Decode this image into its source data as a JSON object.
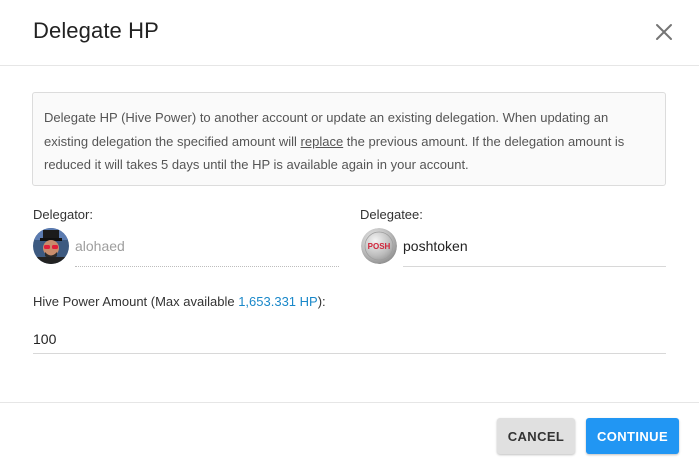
{
  "dialog": {
    "title": "Delegate HP",
    "close_icon": "close-icon"
  },
  "info": {
    "part1": "Delegate HP (Hive Power) to another account or update an existing delegation. When updating an existing delegation the specified amount will ",
    "underlined": "replace",
    "part2": " the previous amount. If the delegation amount is reduced it will takes 5 days until the HP is available again in your account."
  },
  "delegator": {
    "label": "Delegator:",
    "account": "alohaed",
    "avatar_icon": "user-avatar"
  },
  "delegatee": {
    "label": "Delegatee:",
    "account": "poshtoken",
    "avatar_icon": "posh-logo",
    "avatar_text": "POSH"
  },
  "amount": {
    "label_prefix": "Hive Power Amount (Max available ",
    "max_value": "1,653.331 HP",
    "label_suffix": "):",
    "value": "100"
  },
  "buttons": {
    "cancel": "CANCEL",
    "continue": "CONTINUE"
  },
  "colors": {
    "accent": "#2196f3",
    "link": "#1a88c9",
    "cancel_bg": "#e0e0e0"
  }
}
